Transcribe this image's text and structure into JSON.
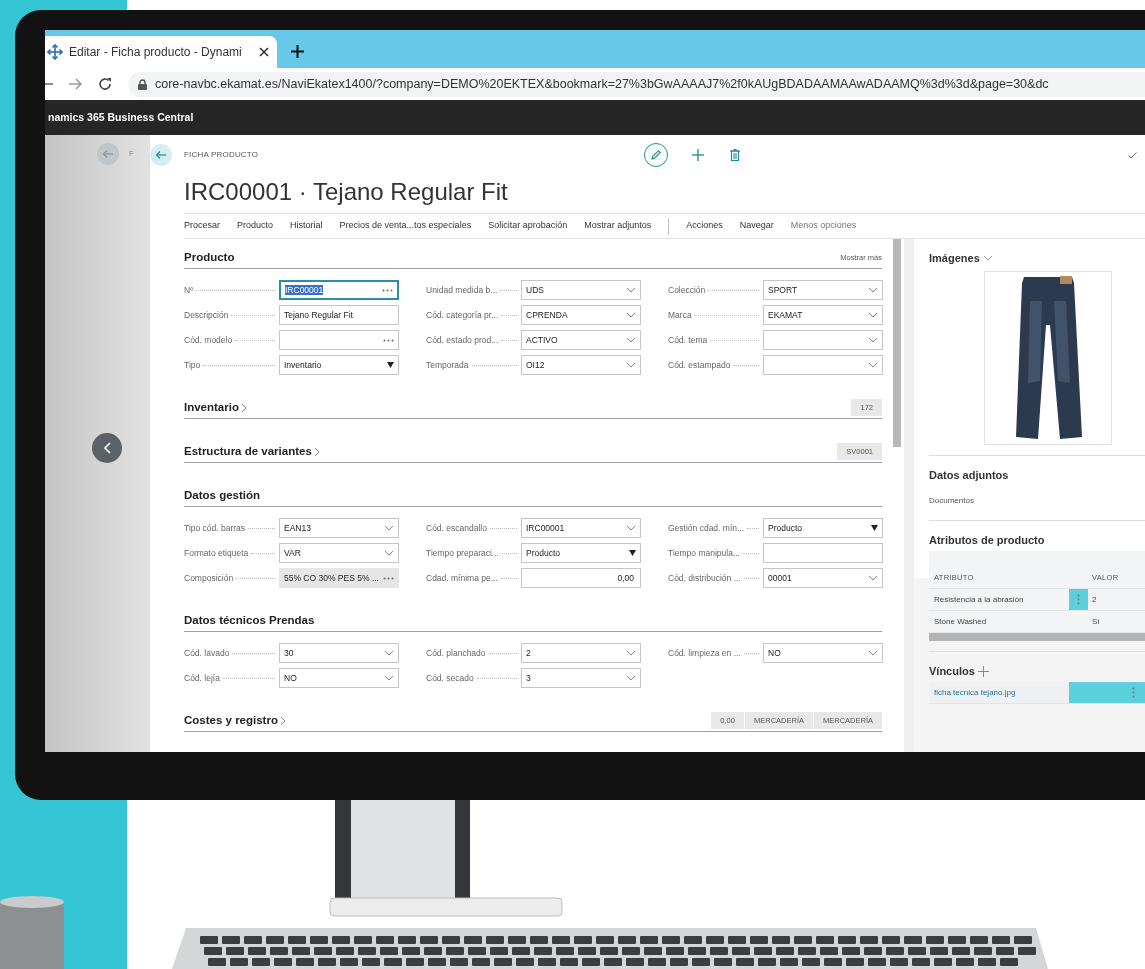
{
  "browser": {
    "tab_title": "Editar - Ficha producto - Dynami",
    "url": "core-navbc.ekamat.es/NaviEkatex1400/?company=DEMO%20EKTEX&bookmark=27%3bGwAAAAJ7%2f0kAUgBDADAAMAAwADAAMQ%3d%3d&page=30&dc"
  },
  "app_bar": {
    "title": "namics 365 Business Central"
  },
  "background_page": {
    "breadcrumb": "F"
  },
  "page": {
    "caption": "FICHA PRODUCTO",
    "title": "IRC00001 · Tejano Regular Fit",
    "actions": [
      {
        "label": "Procesar",
        "kind": "promoted"
      },
      {
        "label": "Producto",
        "kind": "promoted"
      },
      {
        "label": "Historial",
        "kind": "promoted"
      },
      {
        "label": "Precios de venta...tos especiales",
        "kind": "promoted"
      },
      {
        "label": "Solicitar aprobación",
        "kind": "promoted"
      },
      {
        "label": "Mostrar adjuntos",
        "kind": "promoted"
      },
      {
        "label": "Acciones",
        "kind": "menu"
      },
      {
        "label": "Navegar",
        "kind": "menu"
      },
      {
        "label": "Menos opciones",
        "kind": "toggle"
      }
    ],
    "sections": [
      {
        "title": "Producto",
        "expanded": true,
        "link": "Mostrar más",
        "fields": [
          {
            "label": "Nº",
            "value": "IRC00001",
            "kind": "lookup",
            "focused": true
          },
          {
            "label": "Unidad medida b...",
            "value": "UDS",
            "kind": "dropdown",
            "focused": false
          },
          {
            "label": "Colección",
            "value": "SPORT",
            "kind": "dropdown",
            "focused": false
          },
          {
            "label": "Descripción",
            "value": "Tejano Regular Fit",
            "kind": "text",
            "focused": false
          },
          {
            "label": "Cód. categoría pr...",
            "value": "CPRENDA",
            "kind": "dropdown",
            "focused": false
          },
          {
            "label": "Marca",
            "value": "EKAMAT",
            "kind": "dropdown",
            "focused": false
          },
          {
            "label": "Cód. modelo",
            "kind": "lookup",
            "focused": false
          },
          {
            "label": "Cód. estado prod...",
            "value": "ACTIVO",
            "kind": "dropdown",
            "focused": false
          },
          {
            "label": "Cód. tema",
            "kind": "dropdown",
            "focused": false
          },
          {
            "label": "Tipo",
            "value": "Inventario",
            "kind": "select",
            "focused": false
          },
          {
            "label": "Temporada",
            "value": "OI12",
            "kind": "dropdown",
            "focused": false
          },
          {
            "label": "Cód. estampado",
            "kind": "dropdown",
            "focused": false
          }
        ]
      },
      {
        "title": "Inventario",
        "expanded": false,
        "summary": [
          "172"
        ]
      },
      {
        "title": "Estructura de variantes",
        "expanded": false,
        "summary": [
          "SV0001"
        ]
      },
      {
        "title": "Datos gestión",
        "expanded": true,
        "fields": [
          {
            "label": "Tipo cód. barras",
            "value": "EAN13",
            "kind": "dropdown",
            "focused": false
          },
          {
            "label": "Cód. escandallo",
            "value": "IRC00001",
            "kind": "dropdown",
            "focused": false
          },
          {
            "label": "Gestión cdad. mín...",
            "value": "Producto",
            "kind": "select",
            "focused": false
          },
          {
            "label": "Formato etiqueta",
            "value": "VAR",
            "kind": "dropdown",
            "focused": false
          },
          {
            "label": "Tiempo preparaci...",
            "value": "Producto",
            "kind": "select",
            "focused": false
          },
          {
            "label": "Tiempo manipula...",
            "kind": "text",
            "focused": false
          },
          {
            "label": "Composición",
            "value": "55% CO 30% PES 5% ...",
            "kind": "readonly",
            "focused": false
          },
          {
            "label": "Cdad. mínima pe...",
            "value": "0,00",
            "kind": "number",
            "focused": false
          },
          {
            "label": "Cód. distribución ...",
            "value": "00001",
            "kind": "dropdown",
            "focused": false
          }
        ]
      },
      {
        "title": "Datos técnicos Prendas",
        "expanded": true,
        "fields": [
          {
            "label": "Cód. lavado",
            "value": "30",
            "kind": "dropdown",
            "focused": false
          },
          {
            "label": "Cód. planchado",
            "value": "2",
            "kind": "dropdown",
            "focused": false
          },
          {
            "label": "Cód. limpieza en ...",
            "value": "NO",
            "kind": "dropdown",
            "focused": false
          },
          {
            "label": "Cód. lejía",
            "value": "NO",
            "kind": "dropdown",
            "focused": false
          },
          {
            "label": "Cód. secado",
            "value": "3",
            "kind": "dropdown",
            "focused": false
          }
        ]
      },
      {
        "title": "Costes y registro",
        "expanded": false,
        "summary": [
          "0,00",
          "MERCADERÍA",
          "MERCADERÍA"
        ]
      }
    ]
  },
  "factbox": {
    "images": {
      "title": "Imágenes"
    },
    "attachments": {
      "title": "Datos adjuntos",
      "link": "Documentos"
    },
    "attributes": {
      "title": "Atributos de producto",
      "columns": [
        "ATRIBUTO",
        "VALOR"
      ],
      "rows": [
        {
          "attribute": "Resistencia a la abrasión",
          "value": "2",
          "selected": true
        },
        {
          "attribute": "Stone Washed",
          "value": "Sí",
          "selected": false
        }
      ]
    },
    "links": {
      "title": "Vínculos",
      "rows": [
        {
          "name": "ficha tecnica tejano.jpg",
          "selected": true
        }
      ]
    }
  }
}
